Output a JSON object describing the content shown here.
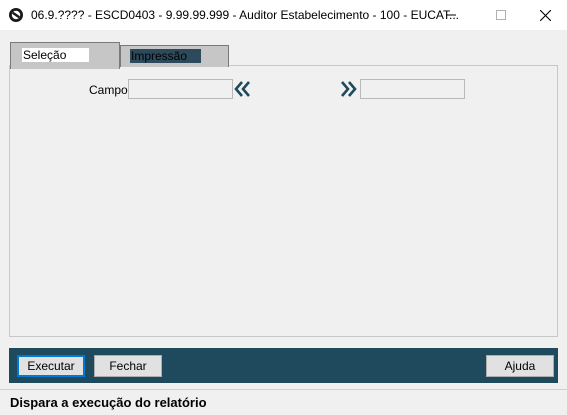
{
  "window": {
    "title": "06.9.???? - ESCD0403 - 9.99.99.999 - Auditor Estabelecimento - 100 - EUCAT...",
    "app_icon": "totvs-logo-icon",
    "controls": [
      "minimize-icon",
      "maximize-icon",
      "close-icon"
    ]
  },
  "tabs": [
    {
      "label": "Seleção",
      "active": true
    },
    {
      "label": "Impressão",
      "active": false
    }
  ],
  "selection": {
    "campo_label": "Campo:",
    "from_value": "",
    "to_value": "",
    "from_icon": "double-chevron-left-icon",
    "to_icon": "double-chevron-right-icon"
  },
  "buttons": {
    "executar": "Executar",
    "fechar": "Fechar",
    "ajuda": "Ajuda"
  },
  "status": {
    "text": "Dispara a execução do relatório"
  },
  "colors": {
    "footer_bar": "#1f4a5e",
    "focus_border": "#0078d7",
    "chevron": "#1f4a5e"
  }
}
